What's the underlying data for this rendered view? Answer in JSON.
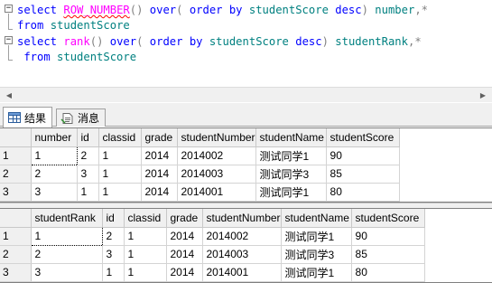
{
  "editor": {
    "lines": [
      {
        "tokens": [
          {
            "t": "select ",
            "c": "kw"
          },
          {
            "t": "ROW_NUMBER",
            "c": "fn ul-red"
          },
          {
            "t": "()",
            "c": "op"
          },
          {
            "t": " over",
            "c": "kw"
          },
          {
            "t": "( ",
            "c": "op"
          },
          {
            "t": "order by",
            "c": "kw"
          },
          {
            "t": " studentScore ",
            "c": "id"
          },
          {
            "t": "desc",
            "c": "kw"
          },
          {
            "t": ")",
            "c": "op"
          },
          {
            "t": " number",
            "c": "id"
          },
          {
            "t": ",*",
            "c": "op"
          }
        ]
      },
      {
        "tokens": [
          {
            "t": "from",
            "c": "kw"
          },
          {
            "t": " studentScore",
            "c": "id"
          }
        ]
      },
      {
        "tokens": [
          {
            "t": "select ",
            "c": "kw"
          },
          {
            "t": "rank",
            "c": "fn"
          },
          {
            "t": "()",
            "c": "op"
          },
          {
            "t": " over",
            "c": "kw"
          },
          {
            "t": "( ",
            "c": "op"
          },
          {
            "t": "order by",
            "c": "kw"
          },
          {
            "t": " studentScore ",
            "c": "id"
          },
          {
            "t": "desc",
            "c": "kw"
          },
          {
            "t": ")",
            "c": "op"
          },
          {
            "t": " studentRank",
            "c": "id"
          },
          {
            "t": ",*",
            "c": "op"
          }
        ]
      },
      {
        "tokens": [
          {
            "t": " from",
            "c": "kw"
          },
          {
            "t": " studentScore",
            "c": "id"
          }
        ]
      }
    ]
  },
  "tabs": [
    {
      "label": "结果",
      "icon": "results-grid-icon",
      "active": true
    },
    {
      "label": "消息",
      "icon": "messages-icon",
      "active": false
    }
  ],
  "grid1": {
    "columns": [
      "number",
      "id",
      "classid",
      "grade",
      "studentNumber",
      "studentName",
      "studentScore"
    ],
    "rows": [
      [
        "1",
        "1",
        "2",
        "1",
        "2014",
        "2014002",
        "测试同学1",
        "90"
      ],
      [
        "2",
        "2",
        "3",
        "1",
        "2014",
        "2014003",
        "测试同学3",
        "85"
      ],
      [
        "3",
        "3",
        "1",
        "1",
        "2014",
        "2014001",
        "测试同学1",
        "80"
      ]
    ]
  },
  "grid2": {
    "columns": [
      "studentRank",
      "id",
      "classid",
      "grade",
      "studentNumber",
      "studentName",
      "studentScore"
    ],
    "rows": [
      [
        "1",
        "1",
        "2",
        "1",
        "2014",
        "2014002",
        "测试同学1",
        "90"
      ],
      [
        "2",
        "2",
        "3",
        "1",
        "2014",
        "2014003",
        "测试同学3",
        "85"
      ],
      [
        "3",
        "3",
        "1",
        "1",
        "2014",
        "2014001",
        "测试同学1",
        "80"
      ]
    ]
  },
  "colors": {
    "keyword": "#0000ff",
    "function": "#ff00ff",
    "identifier": "#008080",
    "operator": "#808080",
    "chrome": "#f0f0f0"
  }
}
